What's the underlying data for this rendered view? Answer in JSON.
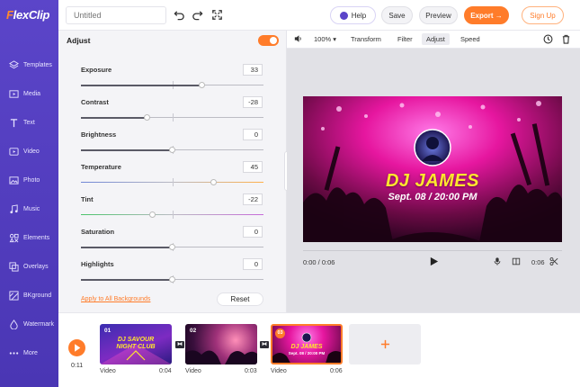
{
  "app": {
    "logo_prefix": "F",
    "logo_rest": "lexClip"
  },
  "sidebar": {
    "items": [
      {
        "label": "Templates",
        "icon": "layers-icon"
      },
      {
        "label": "Media",
        "icon": "media-icon"
      },
      {
        "label": "Text",
        "icon": "text-icon"
      },
      {
        "label": "Video",
        "icon": "video-icon"
      },
      {
        "label": "Photo",
        "icon": "photo-icon"
      },
      {
        "label": "Music",
        "icon": "music-icon"
      },
      {
        "label": "Elements",
        "icon": "elements-icon"
      },
      {
        "label": "Overlays",
        "icon": "overlays-icon"
      },
      {
        "label": "BKground",
        "icon": "background-icon"
      },
      {
        "label": "Watermark",
        "icon": "watermark-icon"
      },
      {
        "label": "More",
        "icon": "more-icon"
      }
    ]
  },
  "topbar": {
    "title_placeholder": "Untitled",
    "help_label": "Help",
    "save_label": "Save",
    "preview_label": "Preview",
    "export_label": "Export →",
    "signup_label": "Sign Up"
  },
  "adjust": {
    "title": "Adjust",
    "enabled": true,
    "controls": [
      {
        "name": "Exposure",
        "value": 33
      },
      {
        "name": "Contrast",
        "value": -28
      },
      {
        "name": "Brightness",
        "value": 0
      },
      {
        "name": "Temperature",
        "value": 45
      },
      {
        "name": "Tint",
        "value": -22
      },
      {
        "name": "Saturation",
        "value": 0
      },
      {
        "name": "Highlights",
        "value": 0
      }
    ],
    "apply_all_label": "Apply to All Backgrounds",
    "reset_label": "Reset"
  },
  "preview_toolbar": {
    "zoom": "100%",
    "tabs": [
      "Transform",
      "Filter",
      "Adjust",
      "Speed"
    ],
    "active_tab": "Adjust"
  },
  "preview": {
    "headline": "DJ JAMES",
    "subline": "Sept. 08 / 20:00 PM",
    "current_time": "0:00 / 0:06",
    "duration": "0:06"
  },
  "timeline": {
    "current_time": "0:11",
    "clips": [
      {
        "num": "01",
        "type": "Video",
        "duration": "0:04",
        "line1": "DJ SAVOUR",
        "line2": "NIGHT CLUB"
      },
      {
        "num": "02",
        "type": "Video",
        "duration": "0:03"
      },
      {
        "num": "03",
        "type": "Video",
        "duration": "0:06",
        "line1": "DJ JAMES",
        "line2": "Sept. 08 / 20:00 PM"
      }
    ]
  },
  "colors": {
    "accent": "#ff7c2a",
    "sidebar": "#5b45c9",
    "title_yellow": "#ffe62e"
  }
}
